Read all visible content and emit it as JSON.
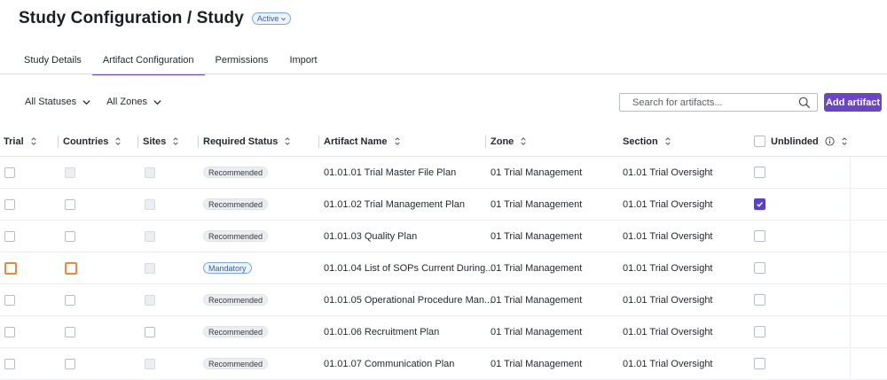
{
  "header": {
    "title": "Study Configuration / Study",
    "status_label": "Active"
  },
  "tabs": [
    {
      "label": "Study Details",
      "active": false
    },
    {
      "label": "Artifact Configuration",
      "active": true
    },
    {
      "label": "Permissions",
      "active": false
    },
    {
      "label": "Import",
      "active": false
    }
  ],
  "filters": {
    "status": "All Statuses",
    "zone": "All Zones"
  },
  "search": {
    "placeholder": "Search for artifacts...",
    "value": ""
  },
  "add_button": "Add artifact",
  "colors": {
    "accent": "#6a45c9",
    "focus_orange": "#e8893e",
    "mandatory_blue": "#2d62b8"
  },
  "table": {
    "columns": [
      "Trial",
      "Countries",
      "Sites",
      "Required Status",
      "Artifact Name",
      "Zone",
      "Section",
      "Unblinded"
    ],
    "rows": [
      {
        "trial": "unchecked",
        "countries": "disabled",
        "sites": "disabled",
        "required": "Recommended",
        "name": "01.01.01 Trial Master File Plan",
        "zone": "01 Trial Management",
        "section": "01.01 Trial Oversight",
        "unblinded": false
      },
      {
        "trial": "unchecked",
        "countries": "unchecked",
        "sites": "disabled",
        "required": "Recommended",
        "name": "01.01.02 Trial Management Plan",
        "zone": "01 Trial Management",
        "section": "01.01 Trial Oversight",
        "unblinded": true
      },
      {
        "trial": "unchecked",
        "countries": "unchecked",
        "sites": "disabled",
        "required": "Recommended",
        "name": "01.01.03 Quality Plan",
        "zone": "01 Trial Management",
        "section": "01.01 Trial Oversight",
        "unblinded": false
      },
      {
        "trial": "focused",
        "countries": "focused",
        "sites": "disabled",
        "required": "Mandatory",
        "name": "01.01.04 List of SOPs Current During...",
        "zone": "01 Trial Management",
        "section": "01.01 Trial Oversight",
        "unblinded": false
      },
      {
        "trial": "unchecked",
        "countries": "unchecked",
        "sites": "disabled",
        "required": "Recommended",
        "name": "01.01.05 Operational Procedure Man...",
        "zone": "01 Trial Management",
        "section": "01.01 Trial Oversight",
        "unblinded": false
      },
      {
        "trial": "unchecked",
        "countries": "unchecked",
        "sites": "unchecked",
        "required": "Recommended",
        "name": "01.01.06 Recruitment Plan",
        "zone": "01 Trial Management",
        "section": "01.01 Trial Oversight",
        "unblinded": false
      },
      {
        "trial": "unchecked",
        "countries": "unchecked",
        "sites": "disabled",
        "required": "Recommended",
        "name": "01.01.07 Communication Plan",
        "zone": "01 Trial Management",
        "section": "01.01 Trial Oversight",
        "unblinded": false
      }
    ]
  }
}
